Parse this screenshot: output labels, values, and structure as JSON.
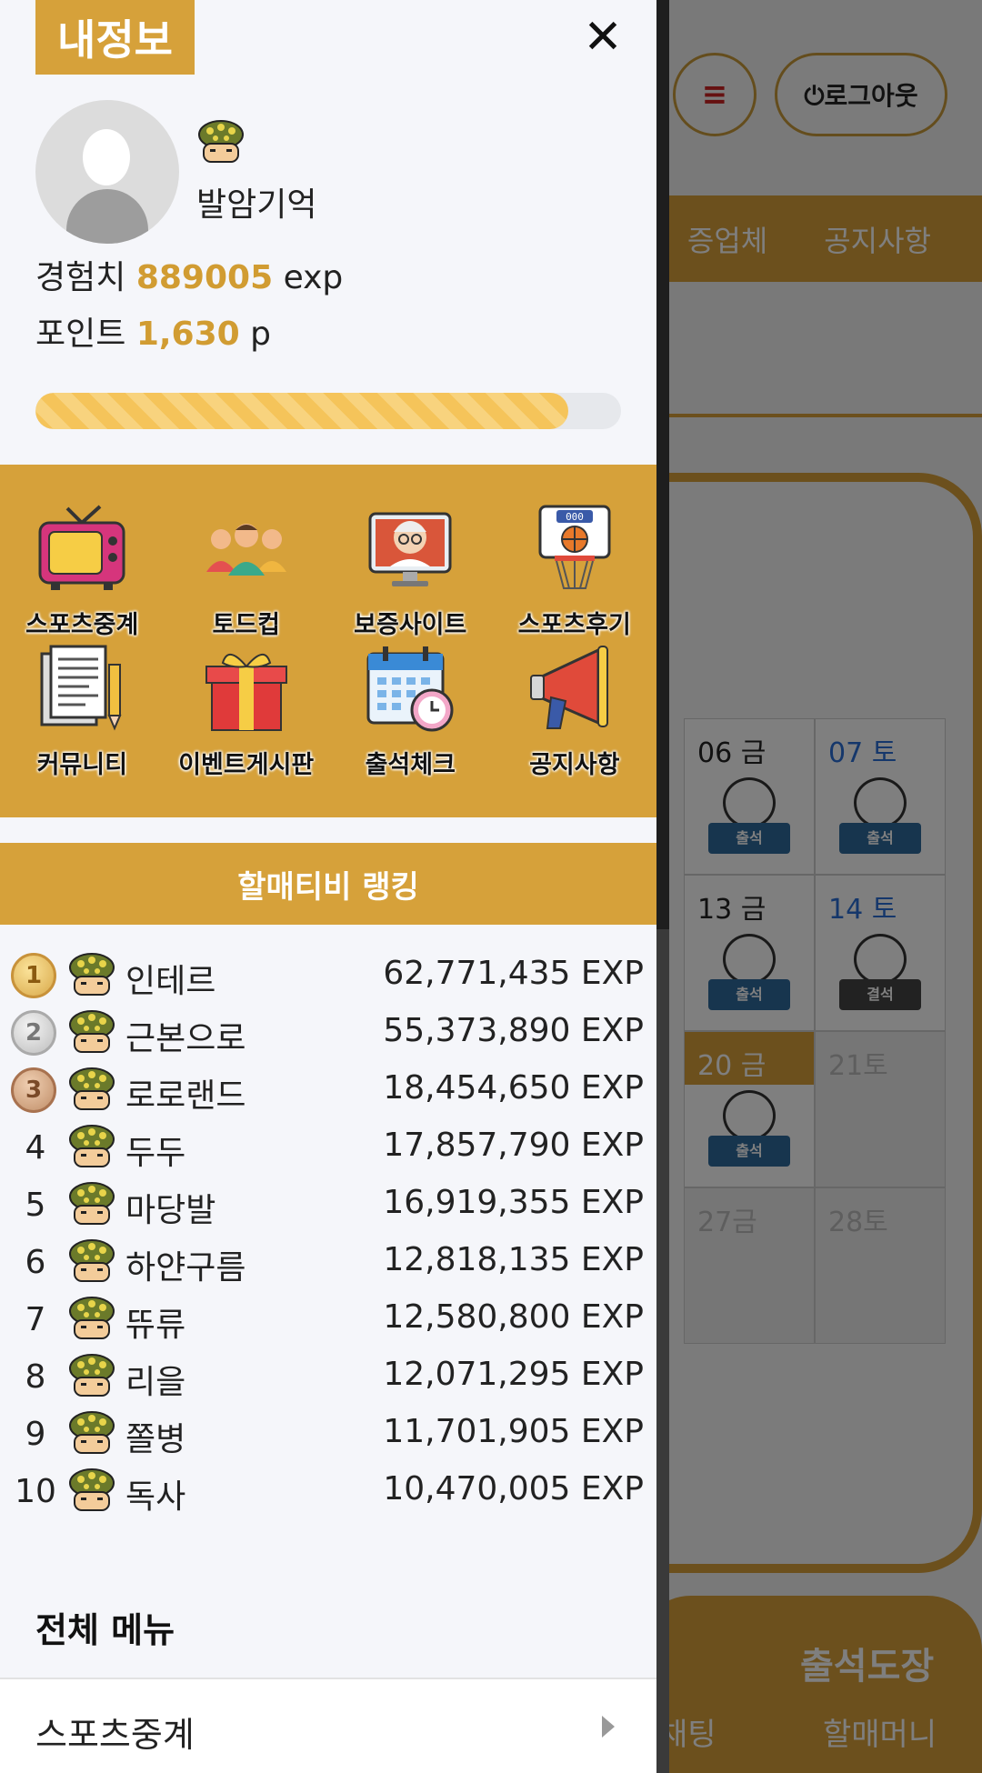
{
  "drawer": {
    "title": "내정보",
    "close_symbol": "✕",
    "username": "발암기억",
    "exp_label": "경험치",
    "exp_value": "889005",
    "exp_unit": "exp",
    "point_label": "포인트",
    "point_value": "1,630",
    "point_unit": "p",
    "progress": 0.91,
    "quick_menu": [
      {
        "label": "스포츠중계",
        "icon": "tv-icon"
      },
      {
        "label": "토드컵",
        "icon": "people-icon"
      },
      {
        "label": "보증사이트",
        "icon": "grandma-monitor-icon"
      },
      {
        "label": "스포츠후기",
        "icon": "basketball-hoop-icon"
      },
      {
        "label": "커뮤니티",
        "icon": "documents-icon"
      },
      {
        "label": "이벤트게시판",
        "icon": "gift-icon"
      },
      {
        "label": "출석체크",
        "icon": "calendar-clock-icon"
      },
      {
        "label": "공지사항",
        "icon": "megaphone-icon"
      }
    ],
    "ranking_title": "할매티비 랭킹",
    "ranking": [
      {
        "rank": "1",
        "name": "인테르",
        "exp": "62,771,435 EXP",
        "medal": "gold"
      },
      {
        "rank": "2",
        "name": "근본으로",
        "exp": "55,373,890 EXP",
        "medal": "silver"
      },
      {
        "rank": "3",
        "name": "로로랜드",
        "exp": "18,454,650 EXP",
        "medal": "bronze"
      },
      {
        "rank": "4",
        "name": "두두",
        "exp": "17,857,790 EXP",
        "medal": ""
      },
      {
        "rank": "5",
        "name": "마당발",
        "exp": "16,919,355 EXP",
        "medal": ""
      },
      {
        "rank": "6",
        "name": "하얀구름",
        "exp": "12,818,135 EXP",
        "medal": ""
      },
      {
        "rank": "7",
        "name": "뜌류",
        "exp": "12,580,800 EXP",
        "medal": ""
      },
      {
        "rank": "8",
        "name": "리을",
        "exp": "12,071,295 EXP",
        "medal": ""
      },
      {
        "rank": "9",
        "name": "쫄병",
        "exp": "11,701,905 EXP",
        "medal": ""
      },
      {
        "rank": "10",
        "name": "독사",
        "exp": "10,470,005 EXP",
        "medal": ""
      }
    ],
    "all_menu_title": "전체 메뉴",
    "menu_item": "스포츠중계"
  },
  "background": {
    "menu_symbol": "≡",
    "logout_label": "⏻로그아웃",
    "nav_items": [
      "증업체",
      "공지사항"
    ],
    "calendar": [
      {
        "day": "06 금",
        "stamp": "출석",
        "style": "",
        "stamp_style": ""
      },
      {
        "day": "07 토",
        "stamp": "출석",
        "style": "blue",
        "stamp_style": ""
      },
      {
        "day": "13 금",
        "stamp": "출석",
        "style": "",
        "stamp_style": ""
      },
      {
        "day": "14 토",
        "stamp": "결석",
        "style": "blue",
        "stamp_style": "dark"
      },
      {
        "day": "20 금",
        "stamp": "출석",
        "style": "today",
        "stamp_style": ""
      },
      {
        "day": "21토",
        "stamp": "",
        "style": "faded",
        "stamp_style": ""
      },
      {
        "day": "27금",
        "stamp": "",
        "style": "faded",
        "stamp_style": ""
      },
      {
        "day": "28토",
        "stamp": "",
        "style": "faded",
        "stamp_style": ""
      }
    ],
    "bottom_title": "출석도장",
    "bottom_links": [
      "채팅",
      "할매머니"
    ]
  },
  "colors": {
    "accent": "#d6a13a",
    "value_text": "#d19c32",
    "progress_fill": "#f5c45a",
    "blue_day": "#2b6fd6"
  }
}
